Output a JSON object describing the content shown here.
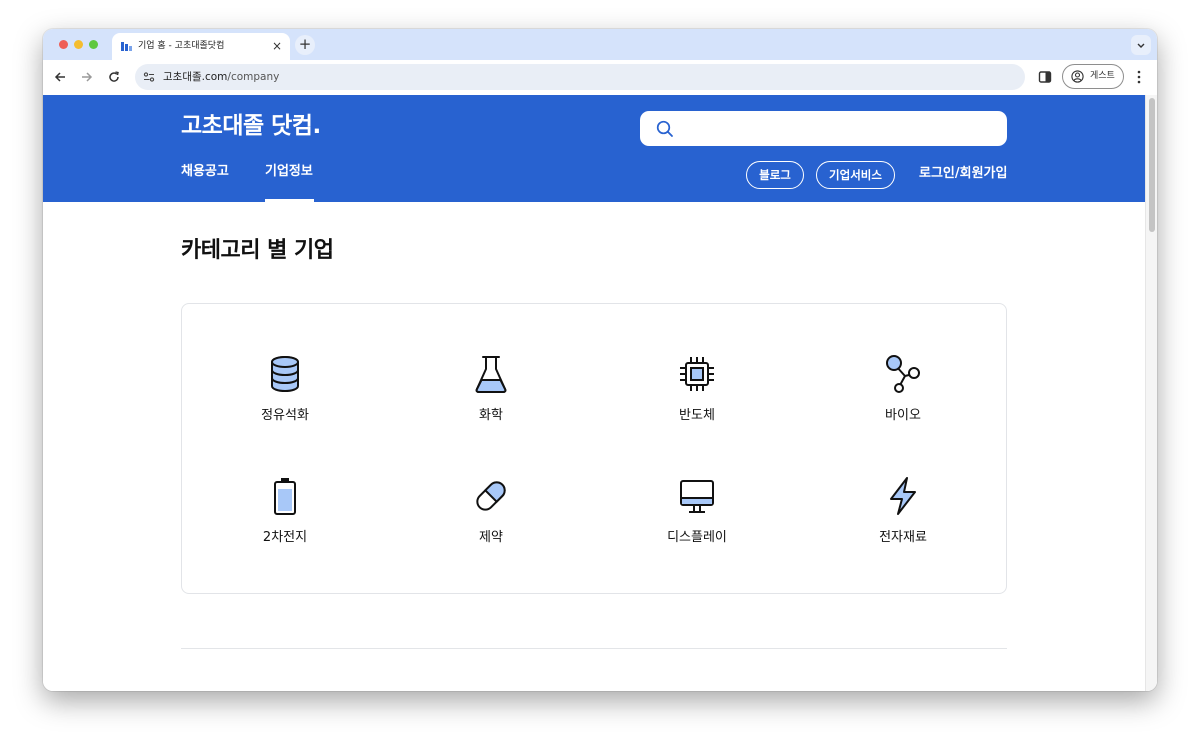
{
  "browser": {
    "tab_title": "기업 홈 - 고초대졸닷컴",
    "tab_close": "×",
    "new_tab": "+",
    "url_domain": "고초대졸.com",
    "url_path": "/company",
    "guest_label": "게스트"
  },
  "site": {
    "logo": "고초대졸 닷컴.",
    "search_placeholder": "",
    "nav_tabs": [
      "채용공고",
      "기업정보"
    ],
    "active_tab": "기업정보",
    "pill_buttons": [
      "블로그",
      "기업서비스"
    ],
    "login_label": "로그인/회원가입",
    "brand_color": "#2862d0"
  },
  "main": {
    "section_title": "카테고리 별 기업",
    "categories": [
      {
        "label": "정유석화",
        "icon": "database-icon"
      },
      {
        "label": "화학",
        "icon": "flask-icon"
      },
      {
        "label": "반도체",
        "icon": "chip-icon"
      },
      {
        "label": "바이오",
        "icon": "molecule-icon"
      },
      {
        "label": "2차전지",
        "icon": "battery-icon"
      },
      {
        "label": "제약",
        "icon": "pill-icon"
      },
      {
        "label": "디스플레이",
        "icon": "monitor-icon"
      },
      {
        "label": "전자재료",
        "icon": "lightning-icon"
      }
    ],
    "icon_fill_color": "#a8c8f8"
  }
}
